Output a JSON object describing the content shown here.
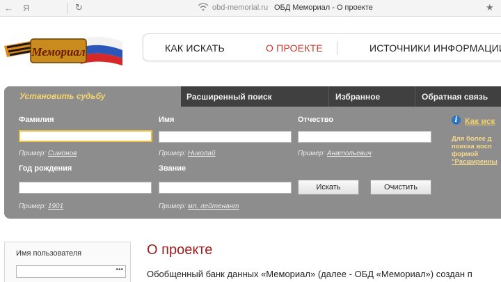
{
  "browser": {
    "back_glyph": "←",
    "yandex_glyph": "Я",
    "reload_glyph": "↻",
    "domain": "obd-memorial.ru",
    "title": "ОБД Мемориал - О проекте",
    "star_glyph": "★"
  },
  "logo": {
    "text": "Мемориал",
    "icon": "memorial-logo-icon"
  },
  "nav": {
    "items": [
      "КАК ИСКАТЬ",
      "О ПРОЕКТЕ",
      "ИСТОЧНИКИ ИНФОРМАЦИИ"
    ],
    "active_color": "#c0392b"
  },
  "search": {
    "tabs": [
      "Установить судьбу",
      "Расширенный поиск",
      "Избранное",
      "Обратная связь"
    ],
    "fields": {
      "surname": {
        "label": "Фамилия",
        "hint_prefix": "Пример: ",
        "hint_example": "Симонов"
      },
      "name": {
        "label": "Имя",
        "hint_prefix": "Пример: ",
        "hint_example": "Николай"
      },
      "patronymic": {
        "label": "Отчество",
        "hint_prefix": "Пример: ",
        "hint_example": "Анатольевич"
      },
      "birth_year": {
        "label": "Год рождения",
        "hint_prefix": "Пример: ",
        "hint_example": "1901"
      },
      "rank": {
        "label": "Звание",
        "hint_prefix": "Пример: ",
        "hint_example": "мл. лейтенант"
      }
    },
    "search_button": "Искать",
    "clear_button": "Очистить",
    "info": {
      "link": "Как иск",
      "text_lines": [
        "Для более д",
        "поиска восп",
        "формой",
        "\"Расширенны"
      ]
    }
  },
  "login": {
    "label": "Имя пользователя",
    "password_mask": "•••"
  },
  "about": {
    "title": "О проекте",
    "text": "Обобщенный банк данных «Мемориал» (далее - ОБД «Мемориал») создан п"
  },
  "colors": {
    "panel": "#8d8d8d",
    "tabstrip": "#404040",
    "accent_yellow": "#f5d76e",
    "title_red": "#9b1c1c"
  }
}
